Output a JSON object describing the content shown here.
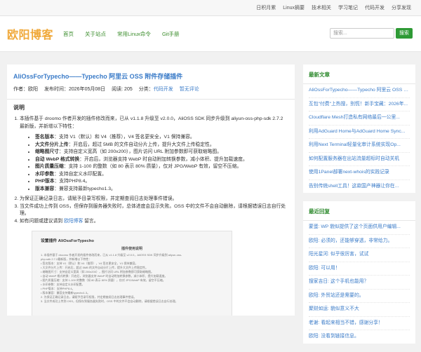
{
  "topnav": [
    "日积月累",
    "Linux摘要",
    "技术相关",
    "学习笔记",
    "代码开发",
    "分享发现"
  ],
  "site": {
    "logo": "欧阳博客"
  },
  "mainnav": [
    "首页",
    "关于站点",
    "常用Linux命令",
    "Git手册"
  ],
  "search": {
    "placeholder": "搜索...",
    "button": "搜索"
  },
  "article": {
    "title": "AliOssForTypecho——Typecho 阿里云 OSS 附件存储插件",
    "author": "作者：欧阳",
    "date": "发布时间：2026年05月08日",
    "views": "阅读: 205",
    "category_label": "分类：",
    "category": "代码开发",
    "comments": "暂无评论",
    "section": "说明",
    "step1": "本插件基于 droomo 作者开发的插件修改而来，已从 v1.1.8 升级至 v2.0.0，AliOSS SDK 同步升级到 aliyun-oss-php-sdk 2.7.2 最新版，并新增以下特性：",
    "step1_link": "droomo",
    "features": [
      {
        "label": "签名版本",
        "text": "：支持 V1（默认）和 V4（推荐），V4 签名更安全，V1 保持兼容。"
      },
      {
        "label": "大文件分片上传",
        "text": "：开启后，超过 5MB 的文件自动分片上传，提升大文件上传稳定性。"
      },
      {
        "label": "缩略图尺寸",
        "text": "：支持自定义宽高（如 200x200），图片访问 URL 附加参数即可获取缩略图。"
      },
      {
        "label": "自动 WebP 格式转换",
        "text": "：开启后，浏览器支持 WebP 时自动附加转换参数，减小体积、提升加载速度。"
      },
      {
        "label": "图片质量压缩",
        "text": "：支持 1-100 的整数（如 80 表示 80% 质量），仅对 JPG/WebP 有效，留空不压缩。"
      },
      {
        "label": "水印参数",
        "text": "：支持自定义水印配置。"
      },
      {
        "label": "PHP版本",
        "text": "：支持PHP8.4。"
      },
      {
        "label": "版本兼容",
        "text": "：兼容支持最新typecho1.3。"
      }
    ],
    "step2": "为保证正确记录日志，请赋予目录写权限，并定期查阅日志处理事件错误。",
    "step3": "当文件成功上传到 OSS，但保存到服务器失败时，总体进度会显示失败。OSS 中的文件不会自动删除，请根据错误日志自行处理。",
    "step4_prefix": "如有问题或建议请到 ",
    "step4_link": "欧阳博客",
    "step4_suffix": " 留言。",
    "screenshot": {
      "title": "设置插件 AliOssForTypecho",
      "heading": "插件使用说明",
      "lines": [
        "1. 本插件基于 droomo 作者开发的插件修改而来，已从 v1.1.8 升级至 v2.0.0，AliOSS SDK 同步升级到 aliyun-oss-",
        "php-sdk 2.7.2最新版，并新增以下特性：",
        "• 签名版本：支持 V1（默认）和 V4（推荐），V4 签名更安全，V1 保持兼容。",
        "• 大文件分片上传：开启后，超过 5MB 的文件自动分片上传，提升大文件上传稳定性。",
        "• 缩略图尺寸：支持自定义宽高（如 200x200），图片访问 URL 附加参数即可获取缩略图。",
        "• 自动 WebP 格式转换：开启后，浏览器支持 WebP 时自动附加转换参数，减小体积、提升加载速度。",
        "• 图片质量压缩：支持 1-100 的整数（如 80 表示 80% 质量），仅对 JPG/WebP 有效，留空不压缩。",
        "• 水印参数：支持自定义水印配置。",
        "• PHP版本：支持PHP8.4。",
        "• 版本兼容：兼容支持最新typecho1.3。",
        "2. 为保证正确记录日志，请赋予目录写权限，并定期查阅日志处理事件错误。",
        "3. 当文件成功上传到 OSS，但保存到服务器失败时，OSS 中的文件不会自动删除，请根据错误日志自行处理。"
      ]
    }
  },
  "recent_posts": {
    "title": "最新文章",
    "items": [
      "AliOssForTypecho——Typecho 阿里云 OSS 附件存储插件",
      "互包\"付费\"上热搜，别慌！新手宝藏：2026年...",
      "Cloudflare Mesh打造私有网络最后一公里...",
      "利用AdGuard Home与AdGuard Home Sync...",
      "利用Next Terminal轻量化审计系统实现Op...",
      "如何配置服务器在出站流量超标时自动关机",
      "使用1Panel部署next-whois的实践记录",
      "告别传统shell工具！这款国产神器让你在..."
    ]
  },
  "recent_comments": {
    "title": "最近回复",
    "items": [
      "蒙蛋: WP 貌似提供了这个页面供用户编辑...",
      "欧阳: 必须的，还能够穿透，非常给力。",
      "阳光星河: 似乎很厉害，试试",
      "欧阳: 可以用！",
      "搜家吉日: 这个手机也能用？",
      "欧阳: 外贸站还是需要的。",
      "聚财如运: 貌似意义不大",
      "老谢: 看起来相当不错，感谢分享！",
      "欧阳: 没看到链接信息。"
    ]
  },
  "colors": {
    "accent": "#2e9a35",
    "link": "#3a7bc8",
    "logo": "#f0a93b"
  }
}
